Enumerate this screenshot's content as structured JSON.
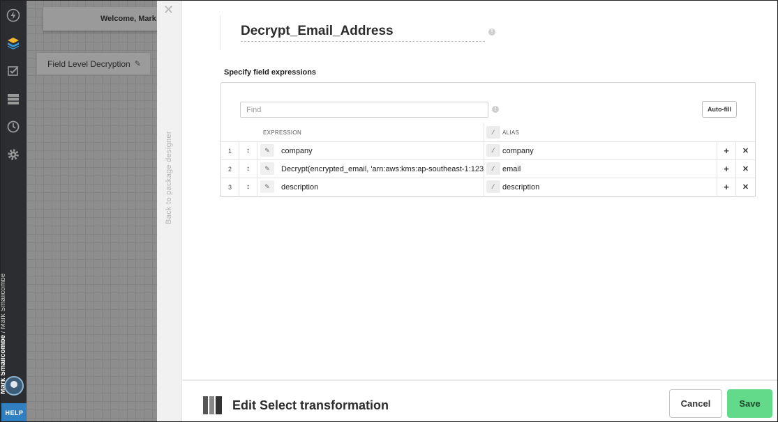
{
  "sidebar": {
    "icons": [
      "lightning-icon",
      "packages-icon",
      "jobs-icon",
      "connections-icon",
      "history-icon",
      "settings-icon"
    ],
    "user_primary": "Mark Smallcombe",
    "user_separator": " / ",
    "user_secondary": "Mark Smallcombe",
    "help_label": "HELP"
  },
  "designer": {
    "welcome_text": "Welcome, Mark :",
    "package_button_label": "Field Level Decryption"
  },
  "back_strip": {
    "back_label": "Back to package designer"
  },
  "component": {
    "name": "Decrypt_Email_Address",
    "section_label": "Specify field expressions",
    "find_placeholder": "Find",
    "autofill_label": "Auto-fill",
    "columns": {
      "expression": "EXPRESSION",
      "alias": "ALIAS"
    },
    "rows": [
      {
        "num": "1",
        "expression": "company",
        "alias": "company"
      },
      {
        "num": "2",
        "expression": "Decrypt(encrypted_email, 'arn:aws:kms:ap-southeast-1:123",
        "alias": "email"
      },
      {
        "num": "3",
        "expression": "description",
        "alias": "description"
      }
    ]
  },
  "footer": {
    "title": "Edit Select transformation",
    "cancel_label": "Cancel",
    "save_label": "Save"
  },
  "colors": {
    "sidebar": "#2b2d31",
    "help": "#2f7fc1",
    "save": "#63d98a"
  }
}
